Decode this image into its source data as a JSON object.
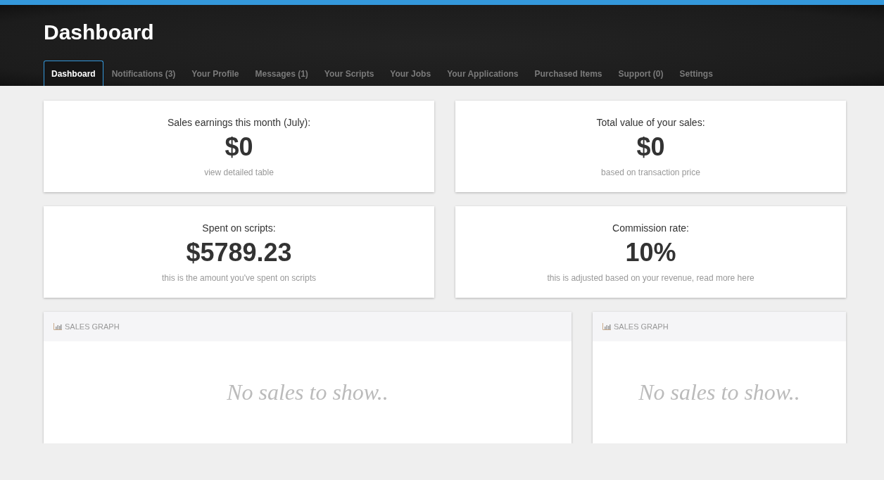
{
  "header": {
    "title": "Dashboard"
  },
  "tabs": [
    {
      "label": "Dashboard",
      "selected": true
    },
    {
      "label": "Notifications (3)",
      "selected": false
    },
    {
      "label": "Your Profile",
      "selected": false
    },
    {
      "label": "Messages (1)",
      "selected": false
    },
    {
      "label": "Your Scripts",
      "selected": false
    },
    {
      "label": "Your Jobs",
      "selected": false
    },
    {
      "label": "Your Applications",
      "selected": false
    },
    {
      "label": "Purchased Items",
      "selected": false
    },
    {
      "label": "Support (0)",
      "selected": false
    },
    {
      "label": "Settings",
      "selected": false
    }
  ],
  "stats": [
    {
      "label": "Sales earnings this month (July):",
      "value": "$0",
      "note": "view detailed table"
    },
    {
      "label": "Total value of your sales:",
      "value": "$0",
      "note": "based on transaction price"
    },
    {
      "label": "Spent on scripts:",
      "value": "$5789.23",
      "note": "this is the amount you've spent on scripts"
    },
    {
      "label": "Commission rate:",
      "value": "10%",
      "note": "this is adjusted based on your revenue, read more here"
    }
  ],
  "graphs": [
    {
      "title": "SALES GRAPH",
      "empty_text": "No sales to show.."
    },
    {
      "title": "SALES GRAPH",
      "empty_text": "No sales to show.."
    }
  ]
}
